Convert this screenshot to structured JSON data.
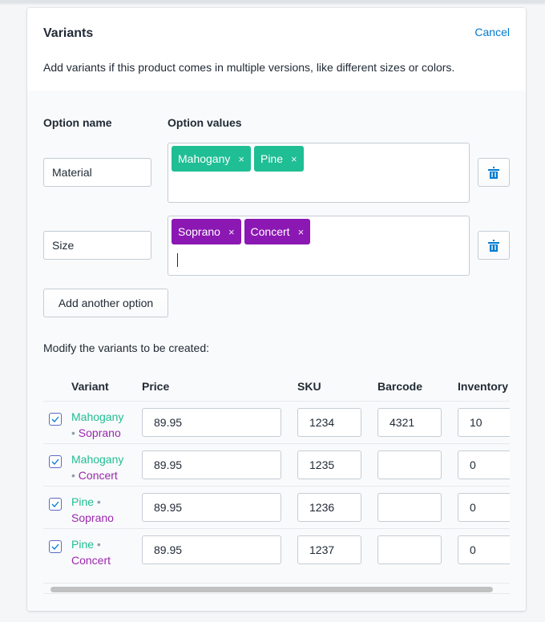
{
  "card": {
    "title": "Variants",
    "cancel_label": "Cancel",
    "description": "Add variants if this product comes in multiple versions, like different sizes or colors."
  },
  "options": {
    "name_header": "Option name",
    "values_header": "Option values",
    "items": [
      {
        "name": "Material",
        "values": [
          "Mahogany",
          "Pine"
        ],
        "tag_color": "#1fbe94",
        "delete_icon": "trash-icon"
      },
      {
        "name": "Size",
        "values": [
          "Soprano",
          "Concert"
        ],
        "tag_color": "#8b18b3",
        "delete_icon": "trash-icon"
      }
    ],
    "tag_remove_glyph": "×",
    "add_option_label": "Add another option"
  },
  "variants": {
    "intro": "Modify the variants to be created:",
    "columns": [
      "Variant",
      "Price",
      "SKU",
      "Barcode",
      "Inventory"
    ],
    "separator": "•",
    "rows": [
      {
        "checked": true,
        "material": "Mahogany",
        "size": "Soprano",
        "price": "89.95",
        "sku": "1234",
        "barcode": "4321",
        "inventory": "10"
      },
      {
        "checked": true,
        "material": "Mahogany",
        "size": "Concert",
        "price": "89.95",
        "sku": "1235",
        "barcode": "",
        "inventory": "0"
      },
      {
        "checked": true,
        "material": "Pine",
        "size": "Soprano",
        "price": "89.95",
        "sku": "1236",
        "barcode": "",
        "inventory": "0"
      },
      {
        "checked": true,
        "material": "Pine",
        "size": "Concert",
        "price": "89.95",
        "sku": "1237",
        "barcode": "",
        "inventory": "0"
      }
    ]
  },
  "colors": {
    "accent": "#007ace",
    "material_color": "#1fbe94",
    "size_color": "#9c27b0",
    "checkbox": "#5c6ac4"
  }
}
